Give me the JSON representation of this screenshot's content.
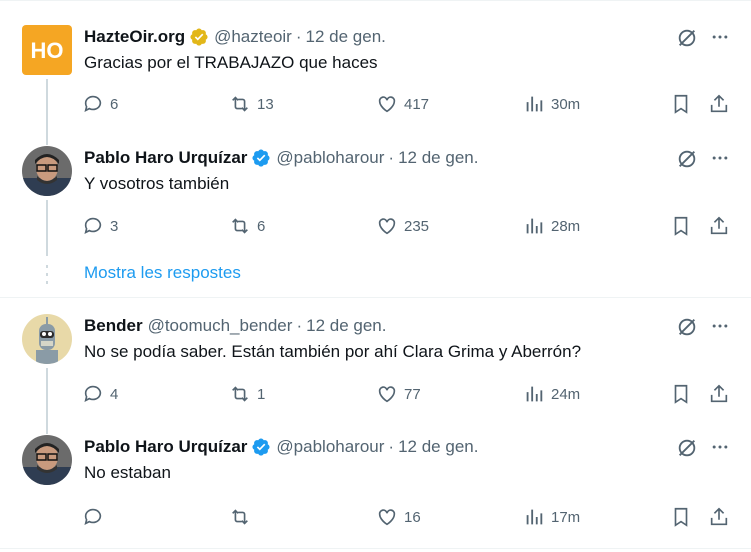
{
  "tweets": [
    {
      "name": "HazteOir.org",
      "handle": "@hazteoir",
      "time": "12 de gen.",
      "text": "Gracias por el TRABAJAZO que haces",
      "badge": "gold",
      "avatar_text": "HO",
      "reply": "6",
      "retweet": "13",
      "like": "417",
      "views": "30m"
    },
    {
      "name": "Pablo Haro Urquízar",
      "handle": "@pabloharour",
      "time": "12 de gen.",
      "text": "Y vosotros también",
      "badge": "blue",
      "reply": "3",
      "retweet": "6",
      "like": "235",
      "views": "28m"
    },
    {
      "name": "Bender",
      "handle": "@toomuch_bender",
      "time": "12 de gen.",
      "text": "No se podía saber. Están también por ahí Clara Grima y Aberrón?",
      "reply": "4",
      "retweet": "1",
      "like": "77",
      "views": "24m"
    },
    {
      "name": "Pablo Haro Urquízar",
      "handle": "@pabloharour",
      "time": "12 de gen.",
      "text": "No estaban",
      "badge": "blue",
      "reply": "",
      "retweet": "",
      "like": "16",
      "views": "17m"
    }
  ],
  "show_replies": "Mostra les respostes",
  "colors": {
    "accent": "#1d9bf0",
    "gold": "#e2b719",
    "hazteoir": "#f5a623",
    "muted": "#536471"
  }
}
